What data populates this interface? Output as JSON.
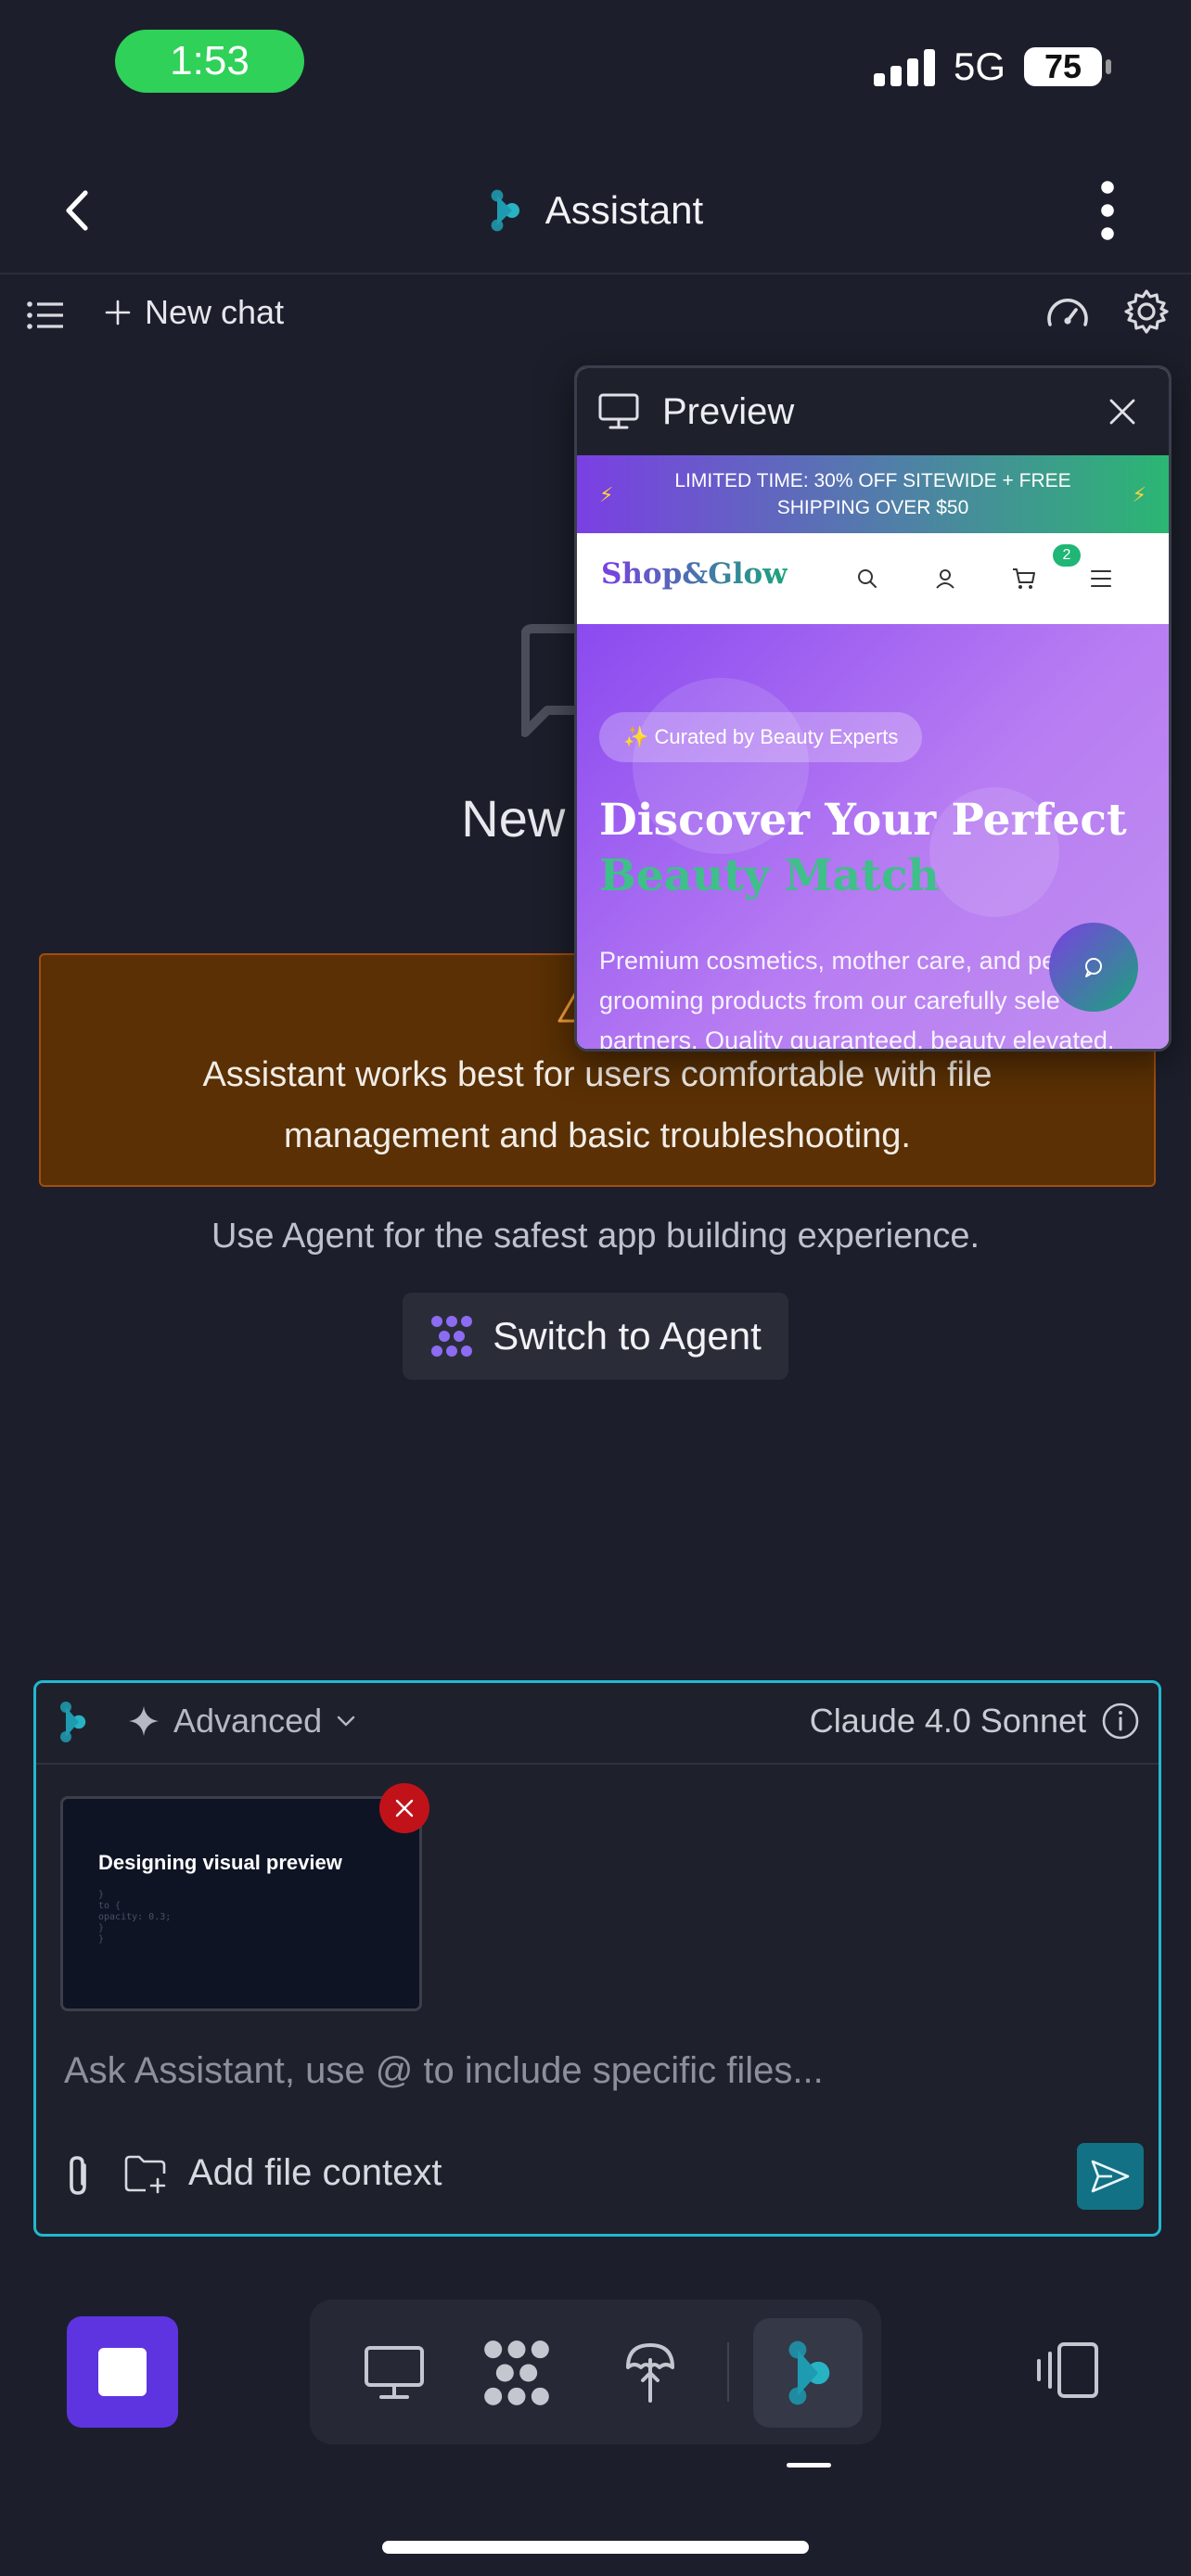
{
  "status": {
    "time": "1:53",
    "network": "5G",
    "battery": "75"
  },
  "header": {
    "title": "Assistant"
  },
  "toolbar": {
    "new_chat": "New chat"
  },
  "empty": {
    "title_visible": "New chat w",
    "warning_title_visible": "V",
    "warning_body": "Assistant works best for users comfortable with file management and basic troubleshooting.",
    "use_agent": "Use Agent for the safest app building experience.",
    "switch_button": "Switch to Agent"
  },
  "preview": {
    "label": "Preview",
    "promo": "LIMITED TIME: 30% OFF SITEWIDE + FREE SHIPPING OVER $50",
    "logo": "Shop&Glow",
    "cart_count": "2",
    "chip": "✨ Curated by Beauty Experts",
    "headline_1": "Discover Your Perfect",
    "headline_2": "Beauty Match",
    "paragraph": "Premium cosmetics, mother care, and pe grooming products from our carefully sele partners. Quality guaranteed, beauty elevated."
  },
  "composer": {
    "mode": "Advanced",
    "model": "Claude 4.0 Sonnet",
    "attachment_title": "Designing visual preview",
    "attachment_code": "}\nto {\nopacity: 0.3;\n}\n}",
    "placeholder": "Ask Assistant, use @ to include specific files...",
    "add_file_context": "Add file context"
  },
  "colors": {
    "accent_teal": "#23b8cf",
    "stop_purple": "#5e34e0",
    "warning_bg": "#5a3004",
    "warning_text": "#f5a03a"
  },
  "icons": [
    "back-icon",
    "assistant-logo-icon",
    "more-vert-icon",
    "list-icon",
    "plus-icon",
    "gauge-icon",
    "gear-icon",
    "chat-bubble-icon",
    "warning-icon",
    "agent-icon",
    "monitor-icon",
    "close-icon",
    "search-icon",
    "user-icon",
    "cart-icon",
    "menu-icon",
    "chat-fab-icon",
    "sparkle-icon",
    "chevron-down-icon",
    "info-icon",
    "paperclip-icon",
    "folder-plus-icon",
    "send-icon",
    "stop-icon",
    "deploy-icon",
    "panels-icon"
  ]
}
